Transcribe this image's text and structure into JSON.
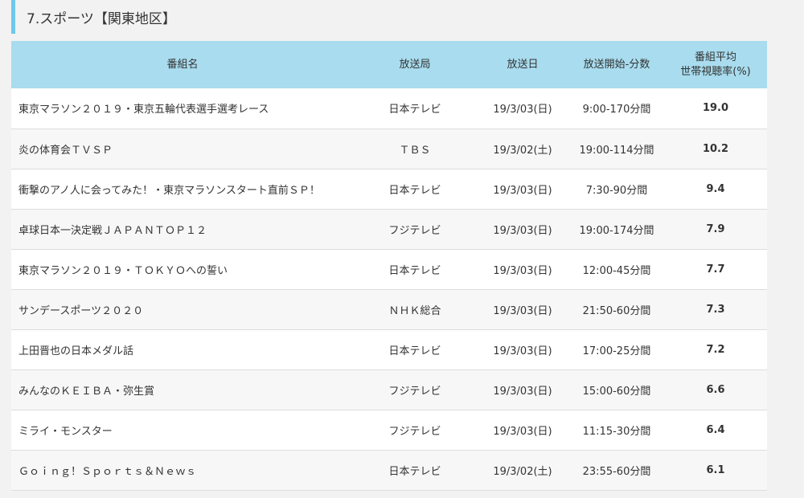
{
  "section": {
    "title": "7.スポーツ【関東地区】",
    "accent_color": "#6ec8e8"
  },
  "table": {
    "header_color": "#a8dcee",
    "headers": {
      "program": "番組名",
      "station": "放送局",
      "date": "放送日",
      "start_duration": "放送開始-分数",
      "rating_line1": "番組平均",
      "rating_line2": "世帯視聴率(%)"
    },
    "rows": [
      {
        "program": "東京マラソン２０１９・東京五輪代表選手選考レース",
        "station": "日本テレビ",
        "date": "19/3/03(日)",
        "start_duration": "9:00-170分間",
        "rating": "19.0"
      },
      {
        "program": "炎の体育会ＴＶＳＰ",
        "station": "ＴＢＳ",
        "date": "19/3/02(土)",
        "start_duration": "19:00-114分間",
        "rating": "10.2"
      },
      {
        "program": "衝撃のアノ人に会ってみた！・東京マラソンスタート直前ＳＰ！",
        "station": "日本テレビ",
        "date": "19/3/03(日)",
        "start_duration": "7:30-90分間",
        "rating": "9.4"
      },
      {
        "program": "卓球日本一決定戦ＪＡＰＡＮＴＯＰ１２",
        "station": "フジテレビ",
        "date": "19/3/03(日)",
        "start_duration": "19:00-174分間",
        "rating": "7.9"
      },
      {
        "program": "東京マラソン２０１９・ＴＯＫＹＯへの誓い",
        "station": "日本テレビ",
        "date": "19/3/03(日)",
        "start_duration": "12:00-45分間",
        "rating": "7.7"
      },
      {
        "program": "サンデースポーツ２０２０",
        "station": "ＮＨＫ総合",
        "date": "19/3/03(日)",
        "start_duration": "21:50-60分間",
        "rating": "7.3"
      },
      {
        "program": "上田晋也の日本メダル話",
        "station": "日本テレビ",
        "date": "19/3/03(日)",
        "start_duration": "17:00-25分間",
        "rating": "7.2"
      },
      {
        "program": "みんなのＫＥＩＢＡ・弥生賞",
        "station": "フジテレビ",
        "date": "19/3/03(日)",
        "start_duration": "15:00-60分間",
        "rating": "6.6"
      },
      {
        "program": "ミライ・モンスター",
        "station": "フジテレビ",
        "date": "19/3/03(日)",
        "start_duration": "11:15-30分間",
        "rating": "6.4"
      },
      {
        "program": "Ｇｏｉｎｇ！Ｓｐｏｒｔｓ＆Ｎｅｗｓ",
        "station": "日本テレビ",
        "date": "19/3/02(土)",
        "start_duration": "23:55-60分間",
        "rating": "6.1"
      }
    ]
  }
}
